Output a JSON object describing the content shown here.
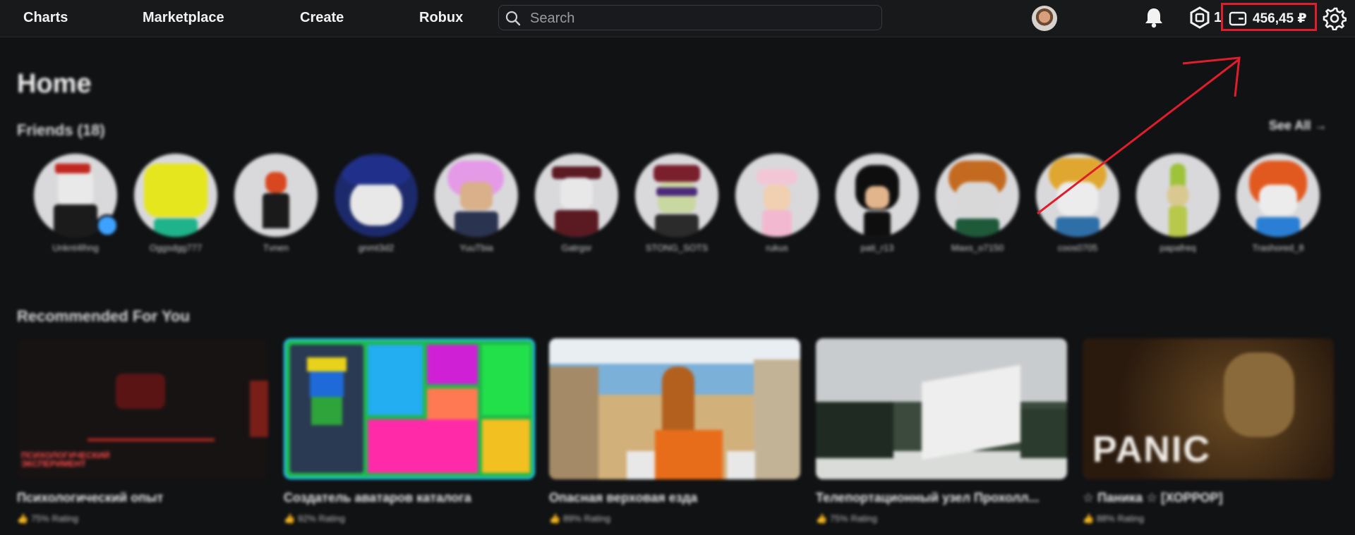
{
  "nav": {
    "charts": "Charts",
    "marketplace": "Marketplace",
    "create": "Create",
    "robux": "Robux"
  },
  "search": {
    "placeholder": "Search",
    "value": ""
  },
  "header": {
    "robux_count": "1",
    "wallet_amount": "456,45 ₽",
    "icons": [
      "search-icon",
      "avatar",
      "bell-icon",
      "robux-icon",
      "wallet-icon",
      "gear-icon"
    ]
  },
  "home": {
    "title": "Home",
    "friends_heading": "Friends (18)",
    "see_all": "See All →",
    "friends": [
      {
        "name": "Unknt4lhng"
      },
      {
        "name": "Oggsdgg777"
      },
      {
        "name": "Tvnen"
      },
      {
        "name": "gnmt3d2"
      },
      {
        "name": "YuuTbia"
      },
      {
        "name": "Gatrgsr"
      },
      {
        "name": "STONG_SOTS"
      },
      {
        "name": "rukus"
      },
      {
        "name": "pati_r13"
      },
      {
        "name": "Maxs_o7150"
      },
      {
        "name": "coos0705"
      },
      {
        "name": "papafreq"
      },
      {
        "name": "Trashored_8"
      }
    ],
    "recommended_heading": "Recommended For You",
    "games": [
      {
        "name": "Психологический опыт",
        "rating": "75% Rating",
        "overlay": "ПСИХОЛОГИЧЕСКИЙ ЭКСПЕРИМЕНТ"
      },
      {
        "name": "Создатель аватаров каталога",
        "rating": "92% Rating",
        "overlay": ""
      },
      {
        "name": "Опасная верховая езда",
        "rating": "89% Rating",
        "overlay": ""
      },
      {
        "name": "Телепортационный узел Прохолл...",
        "rating": "75% Rating",
        "overlay": ""
      },
      {
        "name": "☆ Паника ☆ [ХОРРОР]",
        "rating": "88% Rating",
        "overlay": "PANIC"
      }
    ]
  },
  "colors": {
    "background": "#111214",
    "topbar": "#18191b",
    "annotation_red": "#e11d2b",
    "online_blue": "#3da2ff"
  }
}
